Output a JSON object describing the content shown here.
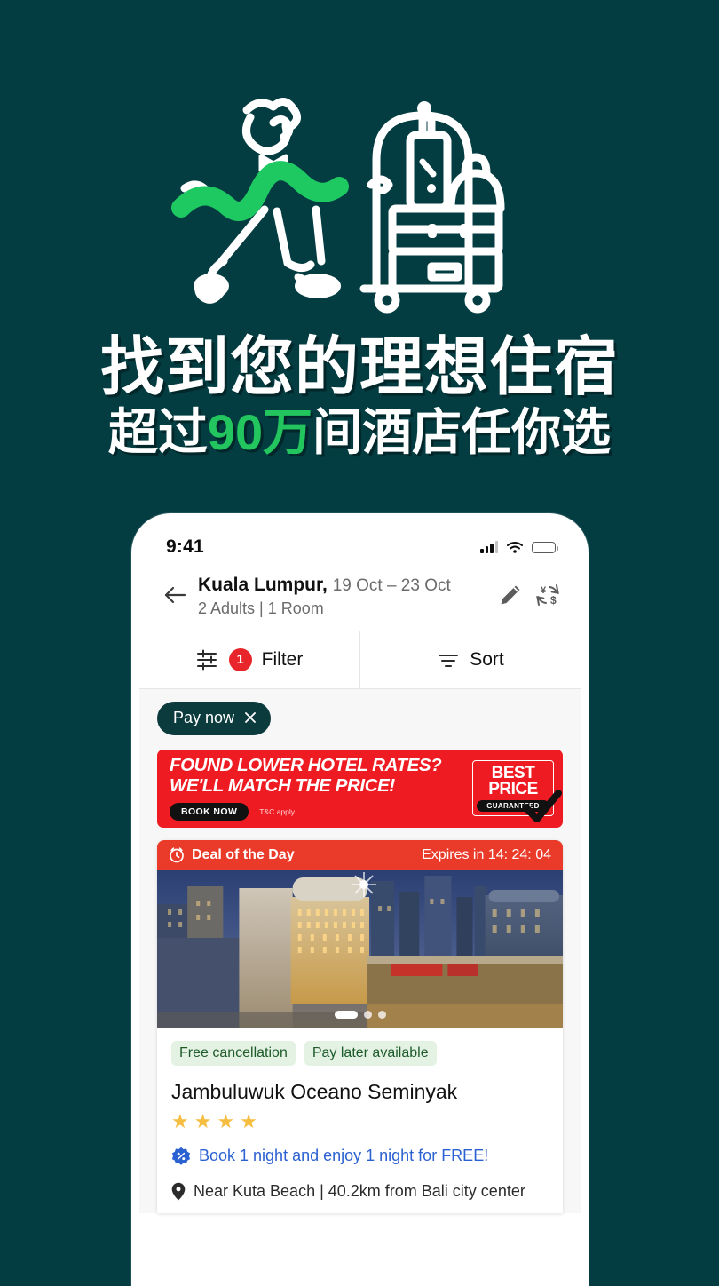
{
  "theme": {
    "background": "#033d41",
    "accent_green": "#22c55e",
    "promo_red": "#ef1b23",
    "deal_red": "#ea3b2a",
    "badge_red": "#e8252a",
    "chip_teal": "#0c3b3e",
    "star_amber": "#f5be41",
    "link_blue": "#2b61d1"
  },
  "hero": {
    "illustration_name": "bellhop-with-luggage-cart-illustration",
    "headline_line1": "找到您的理想住宿",
    "headline_line2_before": "超过",
    "headline_line2_highlight": "90万",
    "headline_line2_after": "间酒店任你选"
  },
  "phone": {
    "status_bar": {
      "time": "9:41",
      "signal_icon": "cellular-signal-icon",
      "wifi_icon": "wifi-icon",
      "battery_icon": "battery-full-icon"
    },
    "search_header": {
      "back_icon": "back-arrow-icon",
      "destination": "Kuala Lumpur,",
      "dates": "19 Oct – 23 Oct",
      "occupancy": "2 Adults  |  1 Room",
      "edit_icon": "pencil-edit-icon",
      "currency_icon": "currency-exchange-icon"
    },
    "filter_sort": {
      "filter_icon": "sliders-filter-icon",
      "filter_count": "1",
      "filter_label": "Filter",
      "sort_icon": "sort-lines-icon",
      "sort_label": "Sort"
    },
    "applied_chips": [
      {
        "label": "Pay now",
        "remove_icon": "close-x-icon"
      }
    ],
    "promo_banner": {
      "line1": "FOUND LOWER HOTEL RATES?",
      "line2": "WE'LL MATCH THE PRICE!",
      "cta": "BOOK NOW",
      "terms": "T&C apply.",
      "seal_line1": "BEST",
      "seal_line2": "PRICE",
      "seal_line3": "GUARANTEED",
      "check_icon": "checkmark-icon"
    },
    "hotel_card": {
      "deal_icon": "alarm-clock-icon",
      "deal_label": "Deal of the Day",
      "expires_label": "Expires in 14: 24: 04",
      "photo_alt": "city-skyline-at-dusk-photo",
      "carousel": {
        "total": 3,
        "active": 1
      },
      "tags": [
        "Free cancellation",
        "Pay later available"
      ],
      "name": "Jambuluwuk Oceano Seminyak",
      "star_rating": 4,
      "star_glyph": "★",
      "offer_icon": "discount-badge-icon",
      "offer_text": "Book 1 night and enjoy 1 night for FREE!",
      "location_icon": "map-pin-icon",
      "location_text": "Near Kuta Beach | 40.2km from Bali city center"
    }
  }
}
